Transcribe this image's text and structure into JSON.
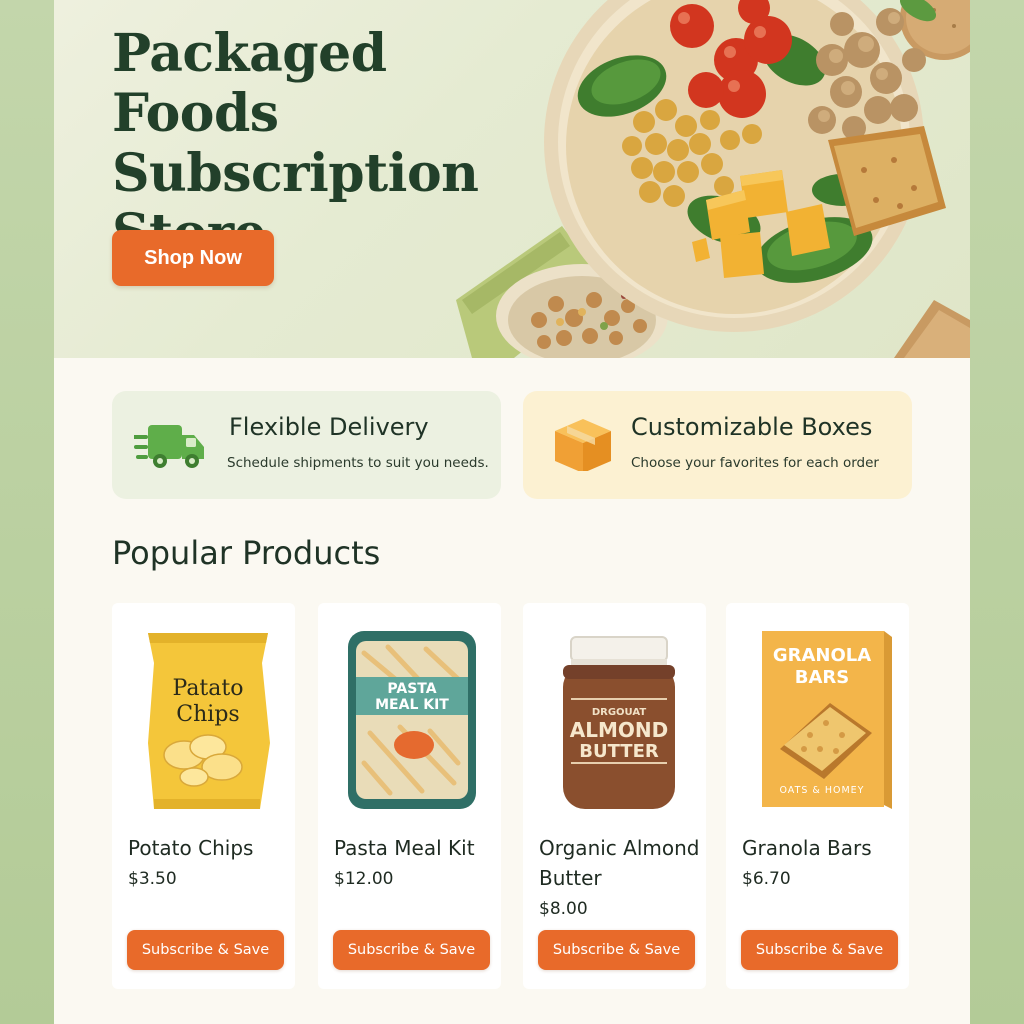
{
  "hero": {
    "title": "Packaged Foods Subscription Store",
    "cta_label": "Shop Now"
  },
  "features": [
    {
      "title": "Flexible Delivery",
      "description": "Schedule shipments to suit you needs.",
      "icon": "delivery-truck-icon"
    },
    {
      "title": "Customizable Boxes",
      "description": "Choose your favorites for each order",
      "icon": "box-icon"
    }
  ],
  "popular": {
    "title": "Popular Products",
    "products": [
      {
        "name": "Potato Chips",
        "price": "$3.50",
        "button_label": "Subscribe & Save",
        "package_text": [
          "Patato",
          "Chips"
        ]
      },
      {
        "name": "Pasta Meal Kit",
        "price": "$12.00",
        "button_label": "Subscribe & Save",
        "package_text": [
          "PASTA",
          "MEAL KIT"
        ]
      },
      {
        "name": "Organic Almond Butter",
        "price": "$8.00",
        "button_label": "Subscribe & Save",
        "package_text": [
          "DRGOUAT",
          "ALMOND",
          "BUTTER"
        ]
      },
      {
        "name": "Granola Bars",
        "price": "$6.70",
        "button_label": "Subscribe & Save",
        "package_text": [
          "GRANOLA",
          "BARS",
          "OATS & HOMEY"
        ]
      }
    ]
  },
  "colors": {
    "accent": "#e86a2a",
    "heading": "#22402a",
    "frame": "#b9cfa0"
  }
}
